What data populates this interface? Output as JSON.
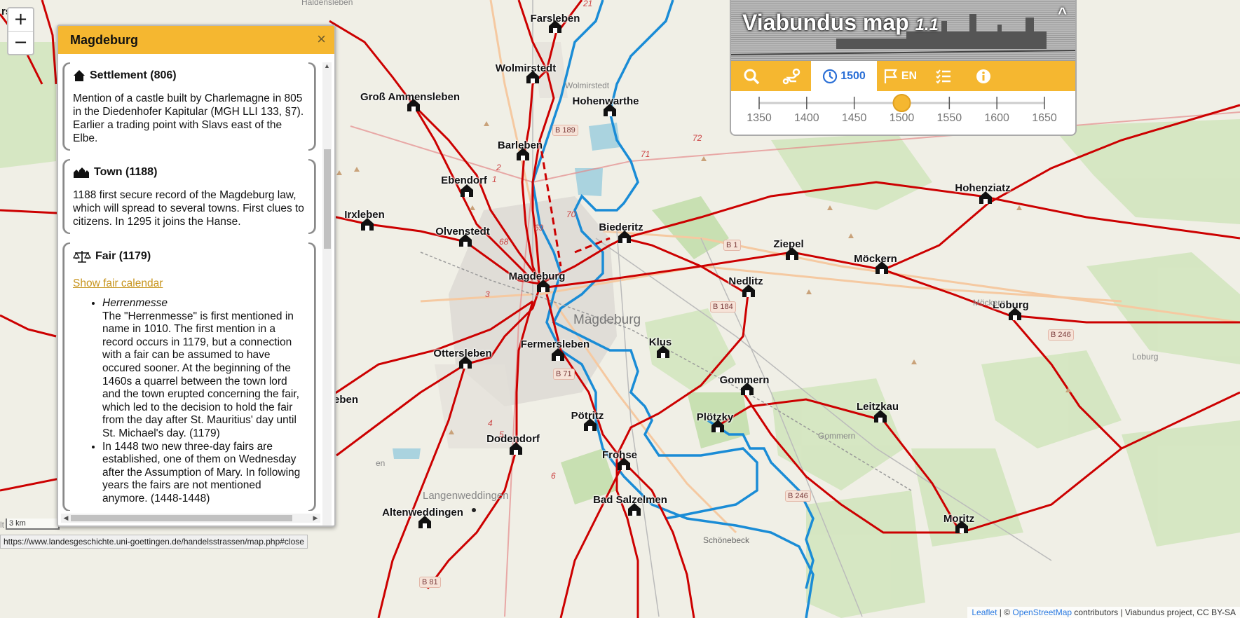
{
  "zoom": {
    "in_label": "+",
    "out_label": "−"
  },
  "popup": {
    "title": "Magdeburg",
    "close_label": "×",
    "settlement": {
      "title": "Settlement (806)",
      "text": "Mention of a castle built by Charlemagne in 805 in the Diedenhofer Kapitular (MGH LLI 133, §7). Earlier a trading point with Slavs east of the Elbe."
    },
    "town": {
      "title": "Town (1188)",
      "text": "1188 first secure record of the Magdeburg law, which will spread to several towns. First clues to citizens. In 1295 it joins the Hanse."
    },
    "fair": {
      "title": "Fair (1179)",
      "link": "Show fair calendar",
      "items": [
        {
          "name": "Herrenmesse",
          "text": "The \"Herrenmesse\" is first mentioned in name in 1010. The first mention in a record occurs in 1179, but a connection with a fair can be assumed to have occured sooner. At the beginning of the 1460s a quarrel between the town lord and the town erupted concerning the fair, which led to the decision to hold the fair from the day after St. Mauritius' day until St. Michael's day. (1179)"
        },
        {
          "name": "",
          "text": "In 1448 two new three-day fairs are established, one of them on Wednesday after the Assumption of Mary. In following years the fairs are not mentioned anymore. (1448-1448)"
        }
      ]
    }
  },
  "panel": {
    "title": "Viabundus map",
    "version": "1.1",
    "collapse_label": "^",
    "tabs": {
      "search": "search-icon",
      "route": "route-icon",
      "year": "1500",
      "lang": "EN",
      "legend": "legend-icon",
      "info": "info-icon"
    },
    "slider": {
      "ticks": [
        "1350",
        "1400",
        "1450",
        "1500",
        "1550",
        "1600",
        "1650"
      ],
      "value": 1500
    }
  },
  "towns": [
    "Farsleben",
    "Wolmirstedt",
    "Groß Ammensleben",
    "Hohenwarthe",
    "Barleben",
    "Ebendorf",
    "Irxleben",
    "Olvenstedt",
    "Biederitz",
    "Magdeburg",
    "Ziepel",
    "Nedlitz",
    "Möckern",
    "Hohenziatz",
    "Loburg",
    "Klus",
    "Ottersleben",
    "Fermersleben",
    "Gommern",
    "Plötzky",
    "Leitzkau",
    "Pötritz",
    "Dodendorf",
    "Frohse",
    "Bad Salzelmen",
    "Altenweddingen",
    "Moritz",
    "eben"
  ],
  "map_text": {
    "city": "Magdeburg",
    "langenweddingen": "Langenweddingen",
    "schonebeck": "Schönebeck",
    "wolmirstedt_base": "Wolmirstedt",
    "mockern_base": "Möckern",
    "gommern_base": "Gommern",
    "hald": "Haldensleben",
    "en": "en",
    "si": "rsi",
    "lt": "lt",
    "loburg_base": "Loburg"
  },
  "road_badges": [
    "B 189",
    "B 1",
    "B 184",
    "B 71",
    "B 246",
    "B 246",
    "B 81"
  ],
  "road_numbers": [
    "21",
    "72",
    "71",
    "70",
    "69",
    "68",
    "1",
    "3",
    "4",
    "5",
    "6",
    "2"
  ],
  "scale": "3 km",
  "attribution": {
    "leaflet": "Leaflet",
    "sep": " | © ",
    "osm": "OpenStreetMap",
    "rest": " contributors | Viabundus project, CC BY-SA"
  },
  "status_url": "https://www.landesgeschichte.uni-goettingen.de/handelsstrassen/map.php#close"
}
